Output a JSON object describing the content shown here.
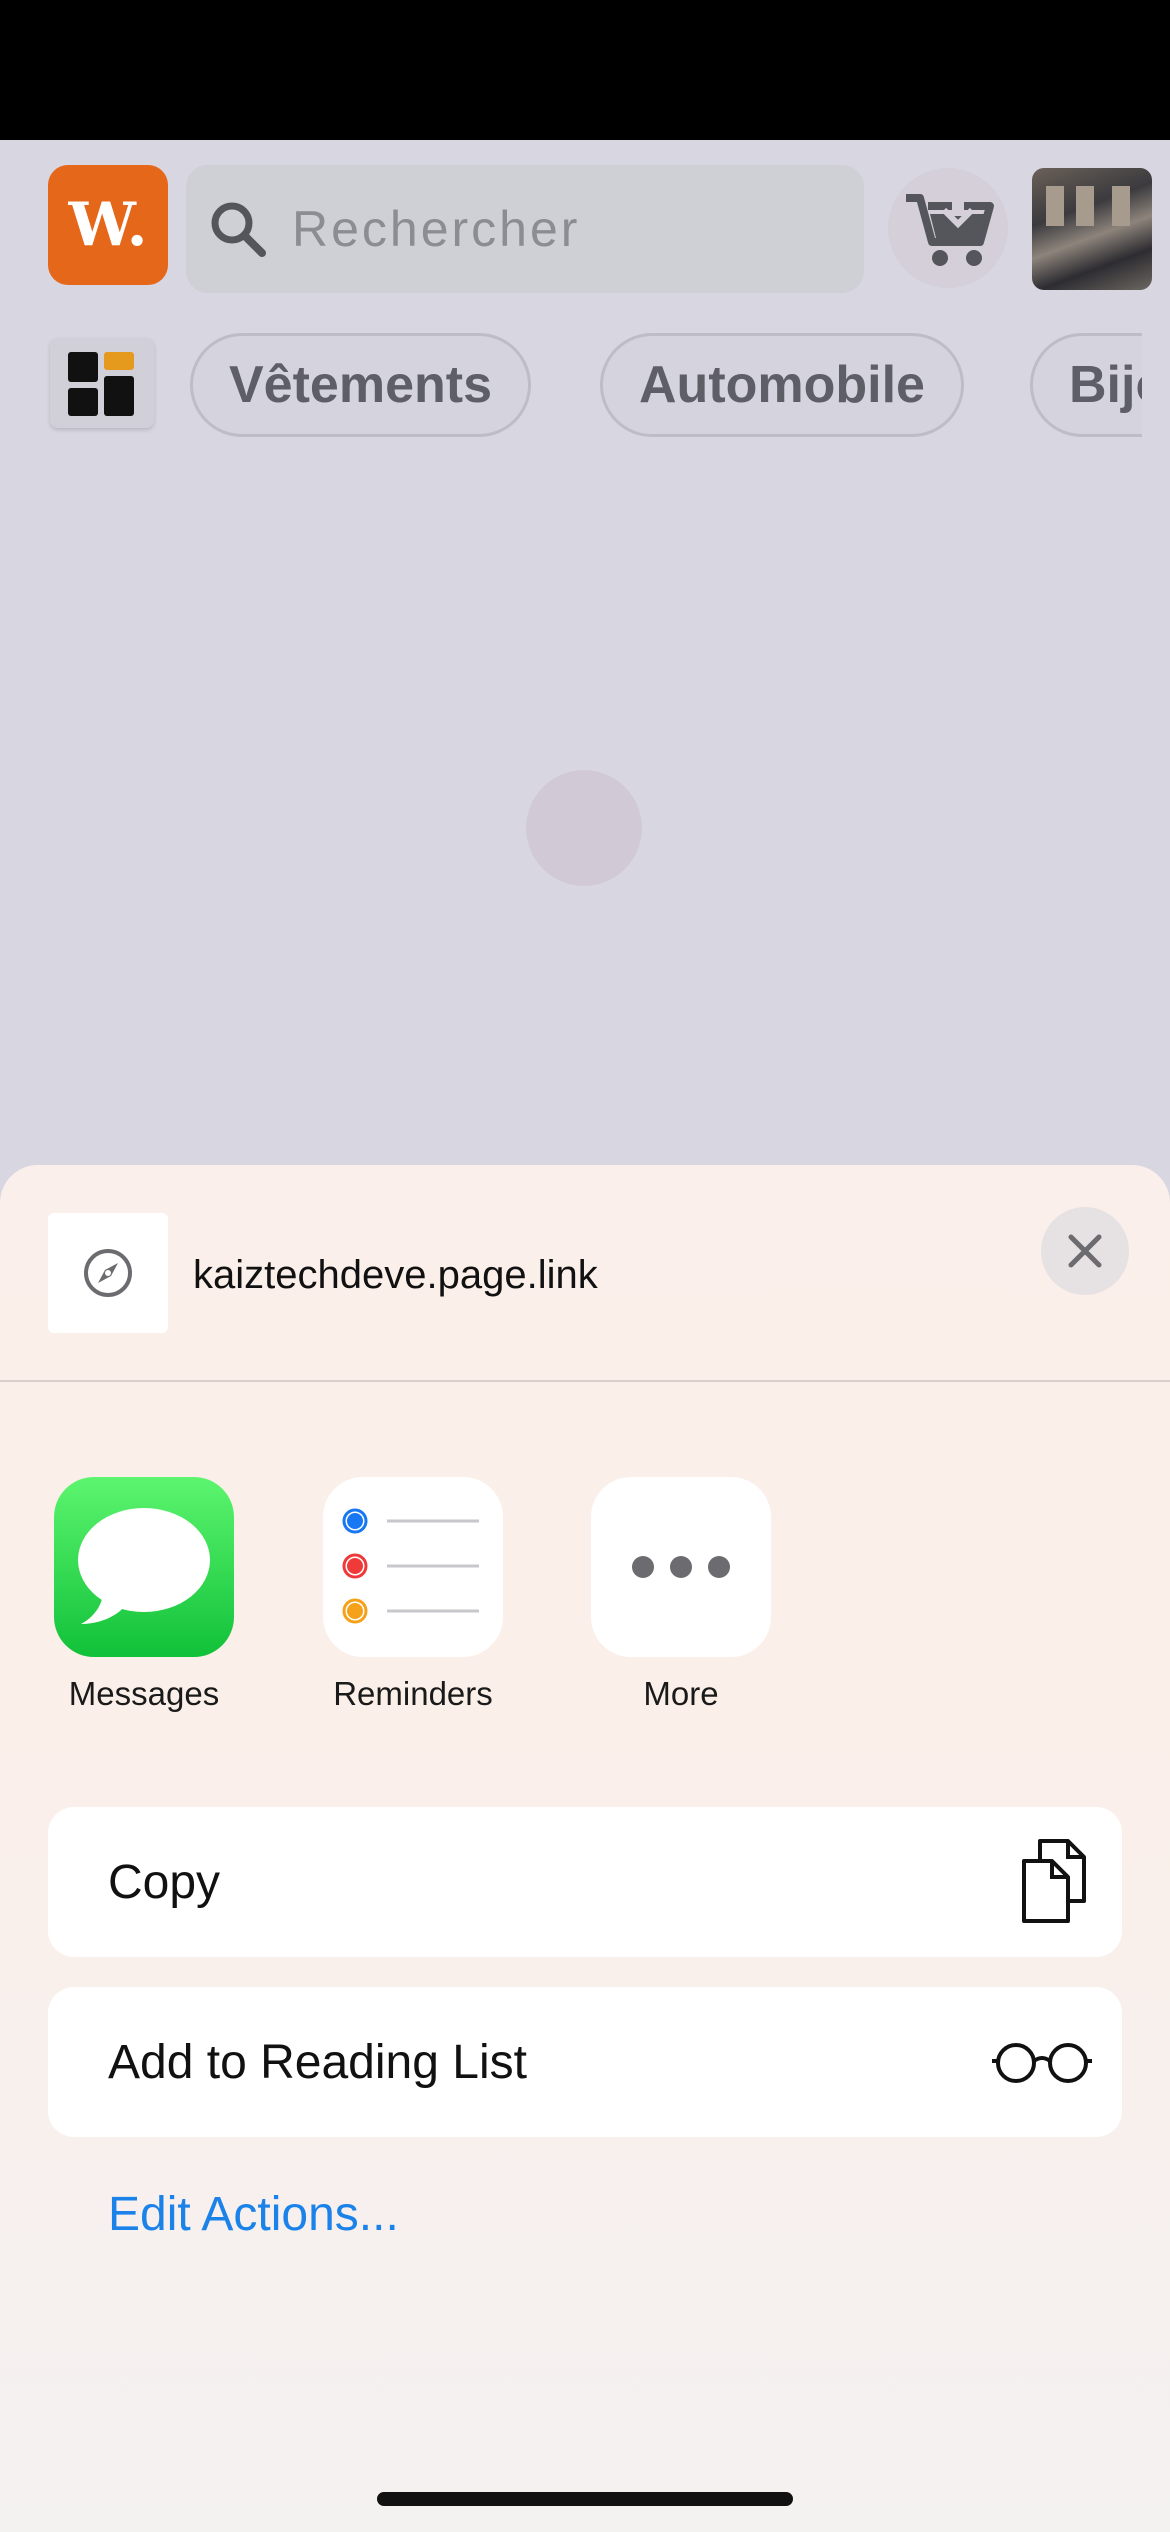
{
  "background_app": {
    "logo_text": "W.",
    "search": {
      "placeholder": "Rechercher"
    },
    "categories": [
      "Vêtements",
      "Automobile",
      "Bijoux"
    ],
    "colors": {
      "logo": "#e5671a"
    }
  },
  "share_sheet": {
    "link": {
      "url": "kaiztechdeve.page.link",
      "icon": "compass-icon"
    },
    "apps": [
      {
        "label": "Messages",
        "icon": "messages-icon"
      },
      {
        "label": "Reminders",
        "icon": "reminders-icon"
      },
      {
        "label": "More",
        "icon": "more-icon"
      }
    ],
    "actions": [
      {
        "label": "Copy",
        "icon": "copy-icon"
      },
      {
        "label": "Add to Reading List",
        "icon": "reading-glasses-icon"
      }
    ],
    "edit_actions_label": "Edit Actions...",
    "colors": {
      "link_blue": "#1a82e8",
      "messages_green": "#11c139"
    }
  }
}
